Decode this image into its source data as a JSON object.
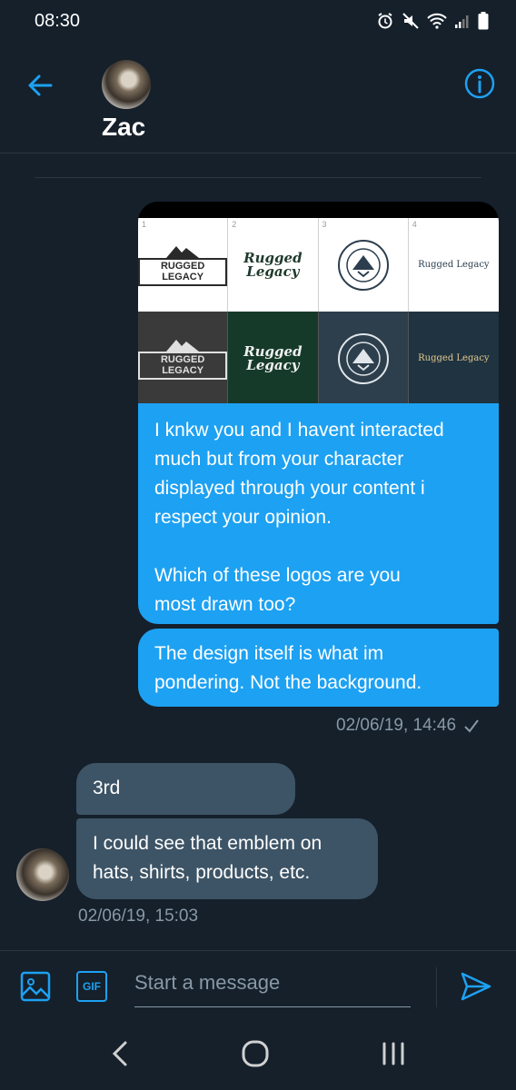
{
  "status_bar": {
    "time": "08:30"
  },
  "header": {
    "contact_name": "Zac"
  },
  "image_card": {
    "cells": [
      {
        "num": "1",
        "logo": "RUGGED LEGACY"
      },
      {
        "num": "2",
        "logo": "Rugged Legacy"
      },
      {
        "num": "3",
        "logo": "RUGGED LEGACY"
      },
      {
        "num": "4",
        "logo": "Rugged Legacy"
      }
    ]
  },
  "messages": {
    "outgoing": [
      {
        "text_lines": [
          "I knkw you and I havent interacted",
          "much but from your character",
          "displayed through your content i",
          "respect your opinion.",
          "",
          "Which of these logos are you",
          "most drawn too?"
        ]
      },
      {
        "text_lines": [
          "The design itself is what im",
          "pondering. Not the background."
        ]
      }
    ],
    "outgoing_timestamp": "02/06/19, 14:46",
    "incoming": [
      {
        "text": "3rd"
      },
      {
        "text_lines": [
          "I could see that emblem on",
          "hats, shirts, products, etc."
        ]
      }
    ],
    "incoming_timestamp": "02/06/19, 15:03"
  },
  "compose": {
    "placeholder": "Start a message",
    "gif_label": "GIF"
  },
  "colors": {
    "accent": "#1da1f2",
    "background": "#15202b",
    "incoming_bubble": "#3d5466",
    "muted": "#8899a6"
  }
}
